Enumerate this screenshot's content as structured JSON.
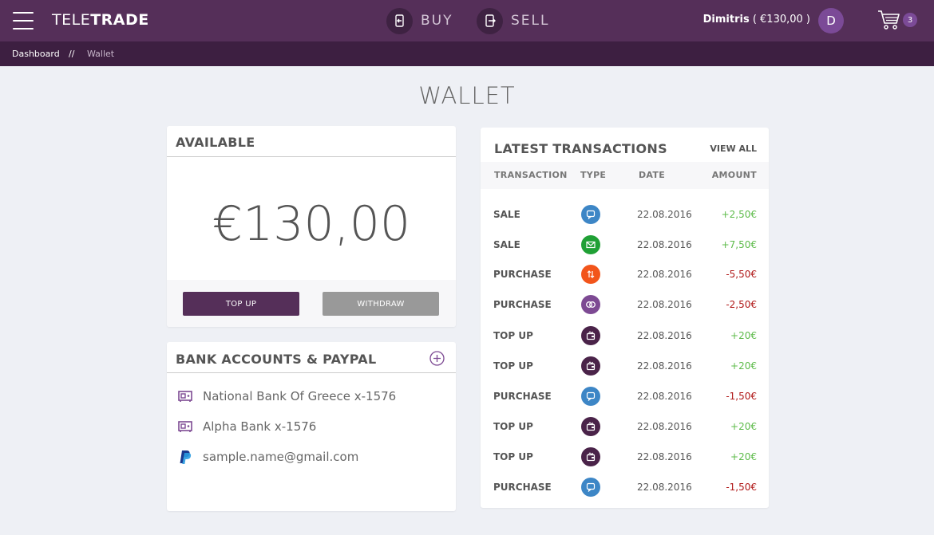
{
  "header": {
    "logo_light": "TELE",
    "logo_bold": "TRADE",
    "buy_label": "BUY",
    "sell_label": "SELL",
    "user_name": "Dimitris",
    "user_balance": "( €130,00 )",
    "avatar_initial": "D",
    "cart_count": "3"
  },
  "breadcrumb": {
    "home": "Dashboard",
    "separator": "//",
    "current": "Wallet"
  },
  "page": {
    "title": "WALLET"
  },
  "available": {
    "title": "AVAILABLE",
    "balance": "€130,00",
    "topup_label": "TOP UP",
    "withdraw_label": "WITHDRAW"
  },
  "bank": {
    "title": "BANK ACCOUNTS & PAYPAL",
    "accounts": [
      {
        "label": "National Bank Of Greece  x-1576",
        "icon": "bank-icon"
      },
      {
        "label": "Alpha Bank  x-1576",
        "icon": "bank-icon"
      },
      {
        "label": "sample.name@gmail.com",
        "icon": "paypal-icon"
      }
    ]
  },
  "transactions": {
    "title": "LATEST TRANSACTIONS",
    "view_all": "VIEW ALL",
    "columns": {
      "transaction": "TRANSACTION",
      "type": "TYPE",
      "date": "DATE",
      "amount": "AMOUNT"
    },
    "rows": [
      {
        "name": "SALE",
        "type_icon": "chat-icon",
        "type_color": "#3d86c6",
        "date": "22.08.2016",
        "amount": "+2,50€",
        "sign": "pos"
      },
      {
        "name": "SALE",
        "type_icon": "mail-icon",
        "type_color": "#1fa035",
        "date": "22.08.2016",
        "amount": "+7,50€",
        "sign": "pos"
      },
      {
        "name": "PURCHASE",
        "type_icon": "exchange-icon",
        "type_color": "#f2551b",
        "date": "22.08.2016",
        "amount": "-5,50€",
        "sign": "neg"
      },
      {
        "name": "PURCHASE",
        "type_icon": "rings-icon",
        "type_color": "#7d4a93",
        "date": "22.08.2016",
        "amount": "-2,50€",
        "sign": "neg"
      },
      {
        "name": "TOP UP",
        "type_icon": "wallet-icon",
        "type_color": "#4a2349",
        "date": "22.08.2016",
        "amount": "+20€",
        "sign": "pos"
      },
      {
        "name": "TOP UP",
        "type_icon": "wallet-icon",
        "type_color": "#4a2349",
        "date": "22.08.2016",
        "amount": "+20€",
        "sign": "pos"
      },
      {
        "name": "PURCHASE",
        "type_icon": "chat-icon",
        "type_color": "#3d86c6",
        "date": "22.08.2016",
        "amount": "-1,50€",
        "sign": "neg"
      },
      {
        "name": "TOP UP",
        "type_icon": "wallet-icon",
        "type_color": "#4a2349",
        "date": "22.08.2016",
        "amount": "+20€",
        "sign": "pos"
      },
      {
        "name": "TOP UP",
        "type_icon": "wallet-icon",
        "type_color": "#4a2349",
        "date": "22.08.2016",
        "amount": "+20€",
        "sign": "pos"
      },
      {
        "name": "PURCHASE",
        "type_icon": "chat-icon",
        "type_color": "#3d86c6",
        "date": "22.08.2016",
        "amount": "-1,50€",
        "sign": "neg"
      }
    ]
  }
}
